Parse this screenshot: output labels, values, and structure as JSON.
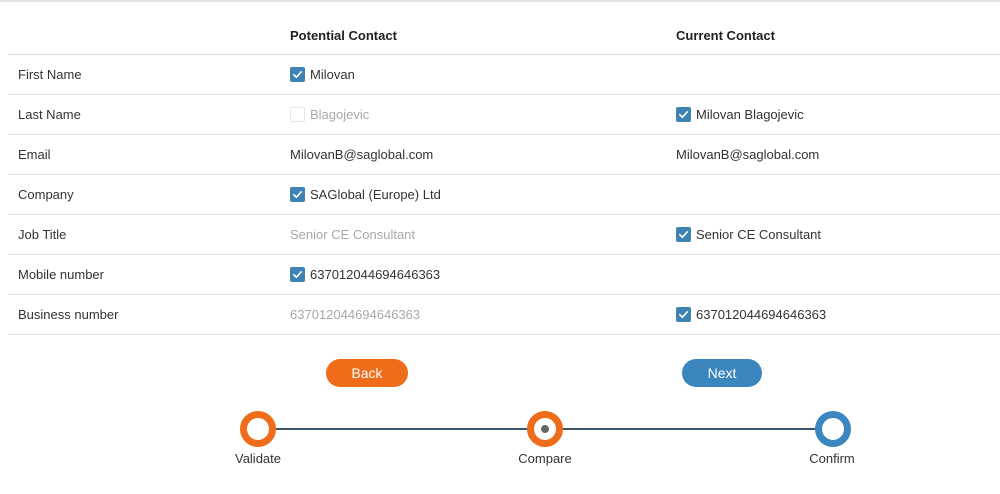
{
  "table": {
    "headers": {
      "field": "",
      "potential": "Potential Contact",
      "current": "Current Contact"
    },
    "rows": [
      {
        "label": "First Name",
        "potential": {
          "value": "Milovan",
          "checkbox": "checked"
        },
        "current": {
          "value": "",
          "checkbox": "none"
        }
      },
      {
        "label": "Last Name",
        "potential": {
          "value": "Blagojevic",
          "checkbox": "unchecked"
        },
        "current": {
          "value": "Milovan Blagojevic",
          "checkbox": "checked"
        }
      },
      {
        "label": "Email",
        "potential": {
          "value": "MilovanB@saglobal.com",
          "checkbox": "none"
        },
        "current": {
          "value": "MilovanB@saglobal.com",
          "checkbox": "none"
        }
      },
      {
        "label": "Company",
        "potential": {
          "value": "SAGlobal (Europe) Ltd",
          "checkbox": "checked"
        },
        "current": {
          "value": "",
          "checkbox": "none"
        }
      },
      {
        "label": "Job Title",
        "potential": {
          "value": "Senior CE Consultant",
          "checkbox": "dim"
        },
        "current": {
          "value": "Senior CE Consultant",
          "checkbox": "checked"
        }
      },
      {
        "label": "Mobile number",
        "potential": {
          "value": "637012044694646363",
          "checkbox": "checked"
        },
        "current": {
          "value": "",
          "checkbox": "none"
        }
      },
      {
        "label": "Business number",
        "potential": {
          "value": "637012044694646363",
          "checkbox": "dim"
        },
        "current": {
          "value": "637012044694646363",
          "checkbox": "checked"
        }
      }
    ]
  },
  "buttons": {
    "back": "Back",
    "next": "Next"
  },
  "stepper": {
    "steps": [
      {
        "label": "Validate",
        "state": "complete"
      },
      {
        "label": "Compare",
        "state": "current"
      },
      {
        "label": "Confirm",
        "state": "upcoming"
      }
    ]
  },
  "colors": {
    "accent_orange": "#ef6c1a",
    "accent_blue": "#3b86be",
    "checkbox_blue": "#3f83b3",
    "dim_text": "#a8a8a8"
  }
}
